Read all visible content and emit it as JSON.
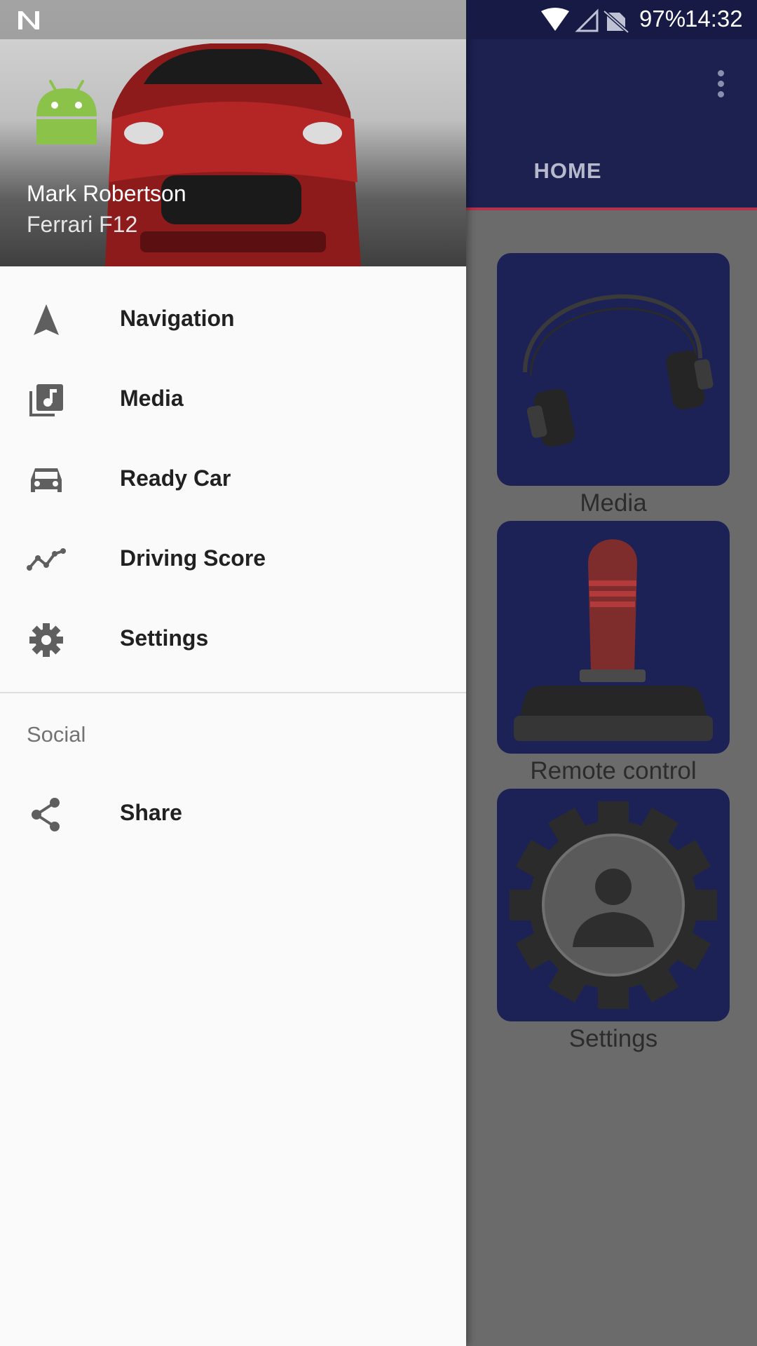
{
  "status_bar": {
    "battery": "97%",
    "time": "14:32",
    "icons": [
      "n-notification-icon",
      "wifi-icon",
      "signal-icon",
      "no-sim-icon"
    ]
  },
  "app_bar": {
    "tab": "HOME",
    "accent_color": "#1c2150",
    "indicator_color": "#b5324a"
  },
  "tiles": [
    {
      "label": "Media",
      "icon": "headphones-icon"
    },
    {
      "label": "Remote control",
      "icon": "joystick-icon"
    },
    {
      "label": "Settings",
      "icon": "gear-profile-icon"
    }
  ],
  "drawer": {
    "header": {
      "user_name": "Mark Robertson",
      "car_name": "Ferrari F12",
      "avatar": "android-avatar-icon",
      "background": "red-ferrari-photo"
    },
    "items": [
      {
        "label": "Navigation",
        "icon": "navigation-arrow-icon"
      },
      {
        "label": "Media",
        "icon": "media-library-icon"
      },
      {
        "label": "Ready Car",
        "icon": "car-icon"
      },
      {
        "label": "Driving Score",
        "icon": "trending-line-icon"
      },
      {
        "label": "Settings",
        "icon": "gear-icon"
      }
    ],
    "section": "Social",
    "social_items": [
      {
        "label": "Share",
        "icon": "share-icon"
      }
    ]
  }
}
